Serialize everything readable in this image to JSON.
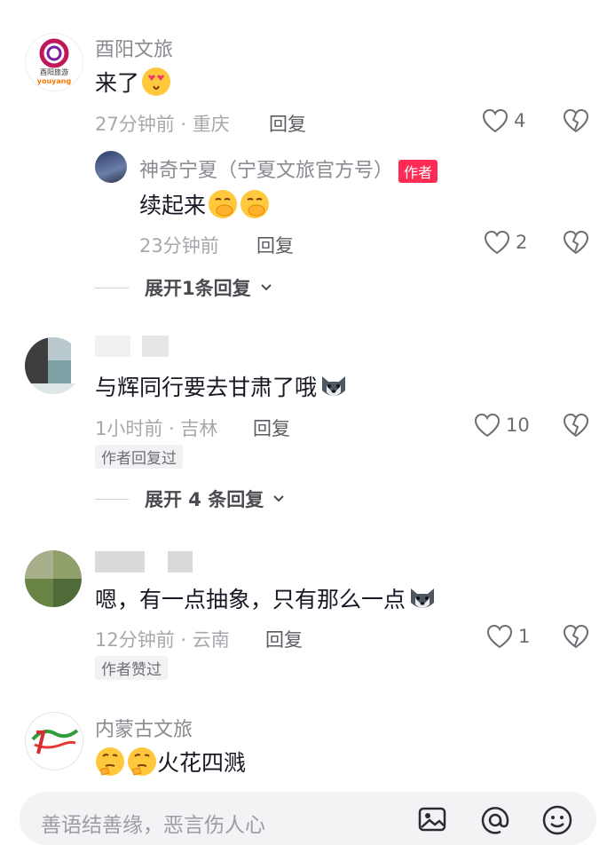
{
  "comments": [
    {
      "username": "酉阳文旅",
      "avatar_text": "酉阳旅游",
      "avatar_logo": "youyang",
      "text": "来了",
      "emoji": [
        "heart-eyes-emoji"
      ],
      "time": "27分钟前",
      "location": "重庆",
      "meta": "27分钟前 · 重庆",
      "reply_label": "回复",
      "likes": "4",
      "reply": {
        "username": "神奇宁夏（宁夏文旅官方号）",
        "badge": "作者",
        "text": "续起来",
        "emoji": [
          "hand-over-mouth-emoji",
          "hand-over-mouth-emoji"
        ],
        "meta": "23分钟前",
        "reply_label": "回复",
        "likes": "2"
      },
      "expand_label": "展开1条回复"
    },
    {
      "username": "",
      "text": "与辉同行要去甘肃了哦",
      "emoji": [
        "wolf-emoji"
      ],
      "meta": "1小时前 · 吉林",
      "reply_label": "回复",
      "likes": "10",
      "tag": "作者回复过",
      "expand_label": "展开 4 条回复"
    },
    {
      "username": "",
      "text": "嗯，有一点抽象，只有那么一点",
      "emoji": [
        "wolf-emoji"
      ],
      "meta": "12分钟前 · 云南",
      "reply_label": "回复",
      "likes": "1",
      "tag": "作者赞过"
    },
    {
      "username": "内蒙古文旅",
      "text": "火花四溅",
      "emoji_before": [
        "thinking-emoji",
        "thinking-emoji"
      ]
    }
  ],
  "input": {
    "placeholder": "善语结善缘，恶言伤人心",
    "icons": [
      "image-icon",
      "at-icon",
      "emoji-icon"
    ]
  },
  "colors": {
    "author_badge": "#fe2c55",
    "name": "#8a8b91",
    "meta": "#a7a8ad"
  }
}
